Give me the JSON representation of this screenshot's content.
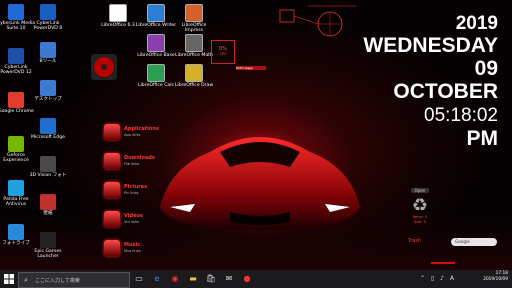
{
  "clock": {
    "year": "2019",
    "weekday": "WEDNESDAY",
    "day": "09",
    "month": "OCTOBER",
    "time": "05:18:02",
    "ampm": "PM"
  },
  "desktop_icons_left": [
    {
      "label": "CyberLink Media Suite 10",
      "color": "#1e6bd6"
    },
    {
      "label": "CyberLink PowerDVD 12",
      "color": "#1e4fa8"
    },
    {
      "label": "Google Chrome",
      "color": "#e33b2e"
    },
    {
      "label": "Geforce Experience",
      "color": "#76b900"
    },
    {
      "label": "Panda Free Antivirus",
      "color": "#1fa3e0"
    },
    {
      "label": "フォトライブ",
      "color": "#2a8bdc"
    }
  ],
  "desktop_icons_left2": [
    {
      "label": "CyberLink PowerDVD 8",
      "color": "#1b5fc0"
    },
    {
      "label": "Bツール",
      "color": "#3a7ad0"
    },
    {
      "label": "デスクトップ",
      "color": "#3d7bd0"
    },
    {
      "label": "Microsoft Edge",
      "color": "#1f6fd0"
    },
    {
      "label": "3D Vision フォト",
      "color": "#4a4a4a"
    },
    {
      "label": "壁紙",
      "color": "#c43030"
    },
    {
      "label": "Epic Games Launcher",
      "color": "#222"
    }
  ],
  "office_icons": [
    {
      "label": "LibreOffice 6.3",
      "color": "#ffffff"
    },
    {
      "label": "LibreOffice Writer",
      "color": "#2a7fd4"
    },
    {
      "label": "LibreOffice Impress",
      "color": "#d4602a"
    },
    {
      "label": "LibreOffice Base",
      "color": "#8a3fb0"
    },
    {
      "label": "LibreOffice Math",
      "color": "#666"
    },
    {
      "label": "LibreOffice Calc",
      "color": "#2aa050"
    },
    {
      "label": "LibreOffice Draw",
      "color": "#d4b02a"
    }
  ],
  "menu": [
    {
      "title": "Applications",
      "sub": "App links"
    },
    {
      "title": "Downloads",
      "sub": "File links"
    },
    {
      "title": "Pictures",
      "sub": "Pic links"
    },
    {
      "title": "Videos",
      "sub": "Vid links"
    },
    {
      "title": "Music",
      "sub": "Mus links"
    }
  ],
  "cpu_widget": {
    "value": "0%",
    "label": "CPU"
  },
  "ram_label": "RAM Usage",
  "recycle": {
    "top_label": "Open",
    "line1": "Items: 0",
    "line2": "Size: 0",
    "trash_label": "Trash"
  },
  "mini_search_placeholder": "Google",
  "taskbar": {
    "search_placeholder": "ここに入力して検索",
    "time": "17:18",
    "date": "2019/10/09"
  },
  "colors": {
    "accent": "#ff2a2a",
    "taskbar": "#1b1b1e"
  }
}
